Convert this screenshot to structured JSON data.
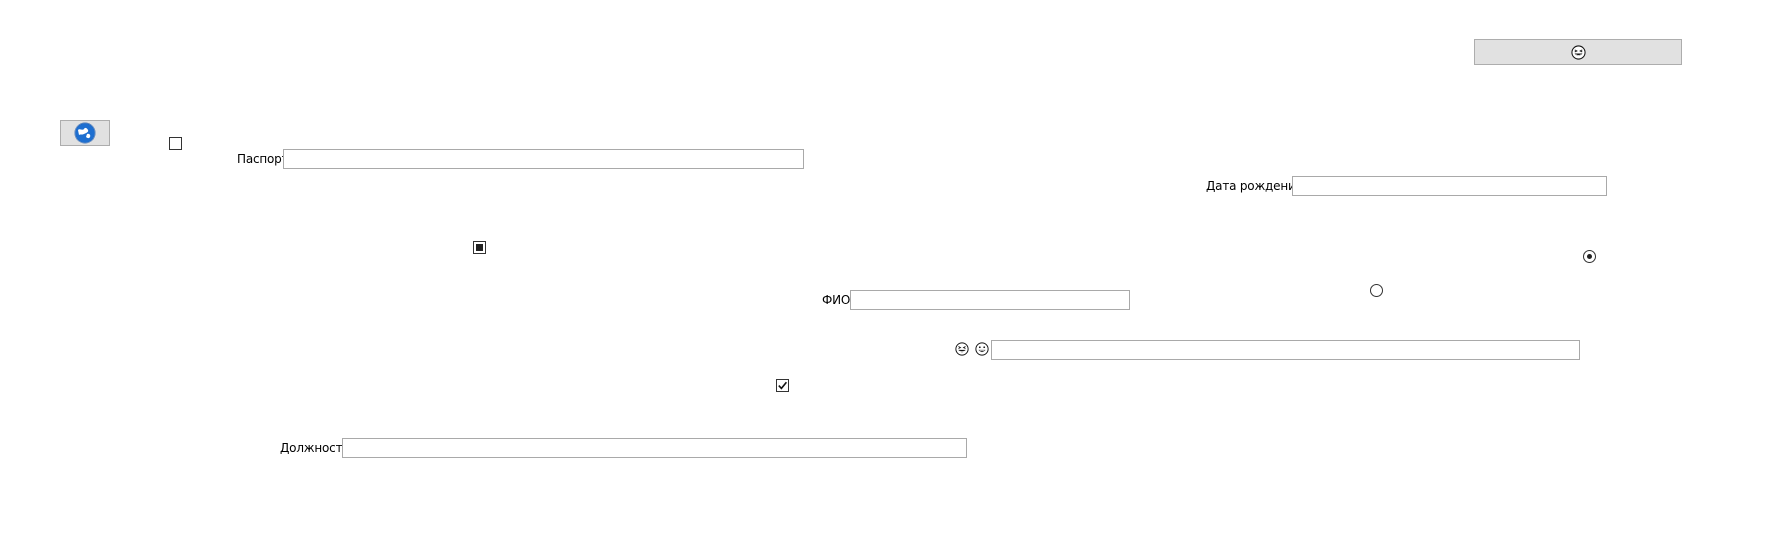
{
  "fields": {
    "passport_label": "Паспорт",
    "birth_date_label": "Дата рождения",
    "fio_label": "ФИО",
    "position_label": "Должность",
    "passport_value": "",
    "birth_date_value": "",
    "fio_value": "",
    "emoji_field_value": "",
    "position_value": ""
  },
  "checkboxes": {
    "checkbox_1": "unchecked",
    "checkbox_2": "indeterminate",
    "checkbox_3": "checked"
  },
  "radios": {
    "radio_1": "selected",
    "radio_2": "unselected"
  },
  "icons": {
    "top_button_icon": "grinning-squint-face-icon",
    "left_button_icon": "globe-icon",
    "emoji_1": "grinning-squint-face-icon",
    "emoji_2": "grinning-face-icon"
  },
  "colors": {
    "button_bg": "#e1e1e1",
    "button_border": "#adadad",
    "field_border": "#a9a9a9",
    "globe_blue": "#1e6fd0"
  }
}
